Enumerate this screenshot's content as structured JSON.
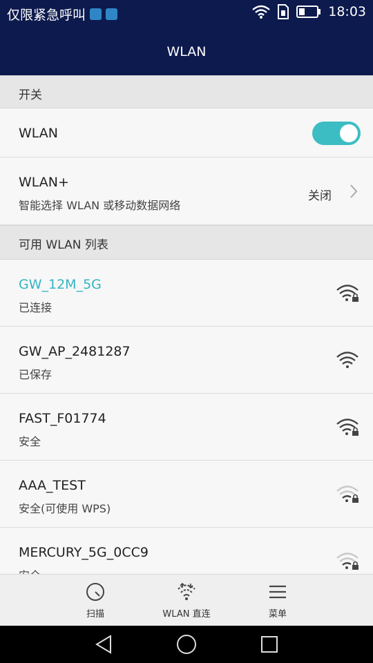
{
  "status_bar": {
    "carrier": "仅限紧急呼叫",
    "time": "18:03"
  },
  "app_bar": {
    "title": "WLAN"
  },
  "sections": {
    "switch_header": "开关",
    "list_header": "可用 WLAN 列表"
  },
  "wlan_toggle": {
    "label": "WLAN",
    "state": "on",
    "accent": "#3cbdc4"
  },
  "wlan_plus": {
    "title": "WLAN+",
    "subtitle": "智能选择 WLAN 或移动数据网络",
    "value": "关闭"
  },
  "networks": [
    {
      "ssid": "GW_12M_5G",
      "status": "已连接",
      "locked": true
    },
    {
      "ssid": "GW_AP_2481287",
      "status": "已保存",
      "locked": false
    },
    {
      "ssid": "FAST_F01774",
      "status": "安全",
      "locked": true
    },
    {
      "ssid": "AAA_TEST",
      "status": "安全(可使用 WPS)",
      "locked": true
    },
    {
      "ssid": "MERCURY_5G_0CC9",
      "status": "安全",
      "locked": true
    }
  ],
  "bottom_nav": {
    "scan": "扫描",
    "direct": "WLAN 直连",
    "menu": "菜单"
  }
}
